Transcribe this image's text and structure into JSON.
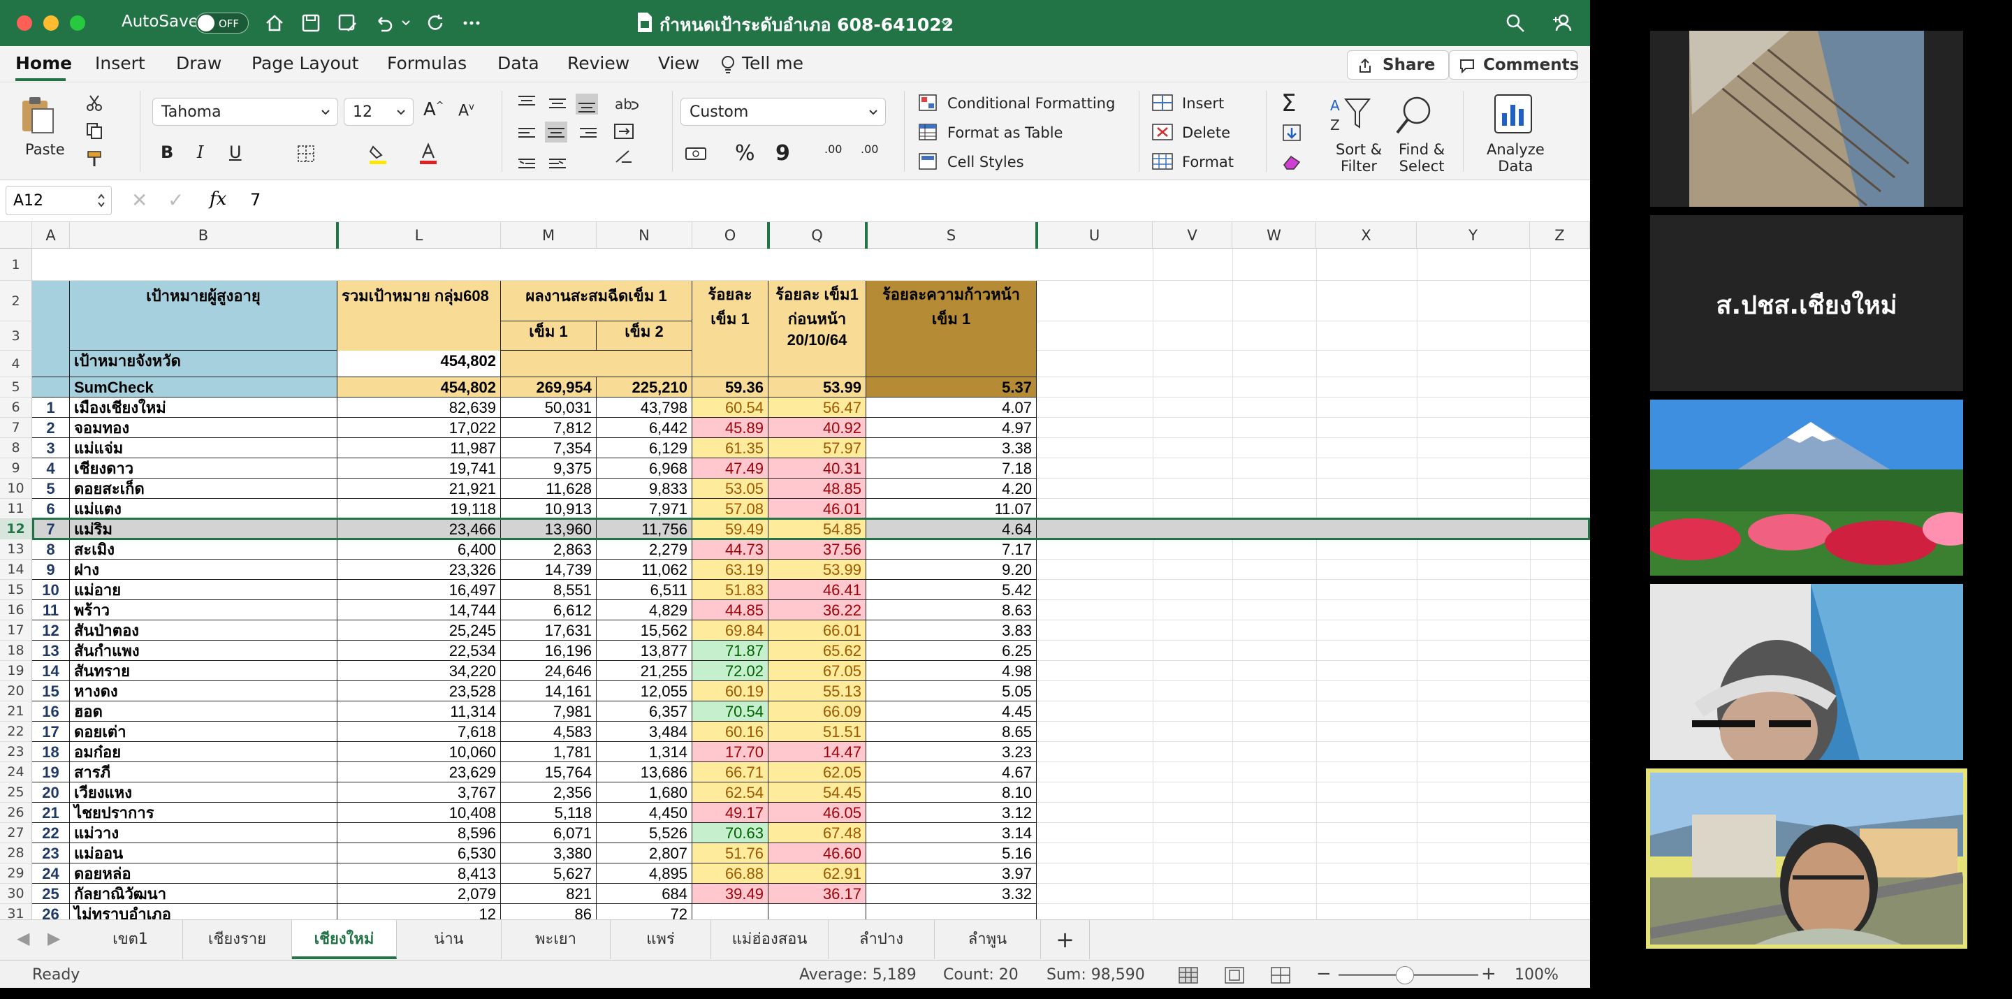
{
  "titlebar": {
    "autosave": "AutoSave",
    "off": "OFF",
    "doc_title": "กำหนดเป้าระดับอำเภอ 608-641022"
  },
  "menu": {
    "home": "Home",
    "insert": "Insert",
    "draw": "Draw",
    "page_layout": "Page Layout",
    "formulas": "Formulas",
    "data": "Data",
    "review": "Review",
    "view": "View",
    "tell_me": "Tell me",
    "share": "Share",
    "comments": "Comments"
  },
  "ribbon": {
    "paste": "Paste",
    "font_name": "Tahoma",
    "font_size": "12",
    "number_format": "Custom",
    "conditional_formatting": "Conditional Formatting",
    "format_as_table": "Format as Table",
    "cell_styles": "Cell Styles",
    "insert": "Insert",
    "delete": "Delete",
    "format": "Format",
    "sort_filter_1": "Sort &",
    "sort_filter_2": "Filter",
    "find_select_1": "Find &",
    "find_select_2": "Select",
    "analyze_1": "Analyze",
    "analyze_2": "Data",
    "bold": "B",
    "italic": "I",
    "underline": "U",
    "percent": "%",
    "comma": "9",
    "dec_inc": ".00",
    "dec_dec": ".00"
  },
  "formula_bar": {
    "name_box": "A12",
    "fx": "fx",
    "value": "7"
  },
  "columns": [
    "A",
    "B",
    "L",
    "M",
    "N",
    "O",
    "Q",
    "S",
    "U",
    "V",
    "W",
    "X",
    "Y",
    "Z"
  ],
  "headers": {
    "b": "เป้าหมายผู้สูงอายุ",
    "l": "รวมเป้าหมาย กลุ่ม608",
    "mn": "ผลงานสะสมฉีดเข็ม 1",
    "m": "เข็ม 1",
    "n": "เข็ม 2",
    "o": "ร้อยละ เข็ม 1",
    "q": "ร้อยละ เข็ม1 ก่อนหน้า 20/10/64",
    "s": "ร้อยละความก้าวหน้า เข็ม 1"
  },
  "province_target": {
    "label": "เป้าหมายจังหวัด",
    "value": "454,802"
  },
  "sumcheck": {
    "label": "SumCheck",
    "l": "454,802",
    "m": "269,954",
    "n": "225,210",
    "o": "59.36",
    "q": "53.99",
    "s": "5.37"
  },
  "rows": [
    {
      "n": "1",
      "name": "เมืองเชียงใหม่",
      "l": "82,639",
      "m": "50,031",
      "nn": "43,798",
      "o": "60.54",
      "q": "56.47",
      "s": "4.07"
    },
    {
      "n": "2",
      "name": "จอมทอง",
      "l": "17,022",
      "m": "7,812",
      "nn": "6,442",
      "o": "45.89",
      "q": "40.92",
      "s": "4.97"
    },
    {
      "n": "3",
      "name": "แม่แจ่ม",
      "l": "11,987",
      "m": "7,354",
      "nn": "6,129",
      "o": "61.35",
      "q": "57.97",
      "s": "3.38"
    },
    {
      "n": "4",
      "name": "เชียงดาว",
      "l": "19,741",
      "m": "9,375",
      "nn": "6,968",
      "o": "47.49",
      "q": "40.31",
      "s": "7.18"
    },
    {
      "n": "5",
      "name": "ดอยสะเก็ด",
      "l": "21,921",
      "m": "11,628",
      "nn": "9,833",
      "o": "53.05",
      "q": "48.85",
      "s": "4.20"
    },
    {
      "n": "6",
      "name": "แม่แตง",
      "l": "19,118",
      "m": "10,913",
      "nn": "7,971",
      "o": "57.08",
      "q": "46.01",
      "s": "11.07"
    },
    {
      "n": "7",
      "name": "แม่ริม",
      "l": "23,466",
      "m": "13,960",
      "nn": "11,756",
      "o": "59.49",
      "q": "54.85",
      "s": "4.64"
    },
    {
      "n": "8",
      "name": "สะเมิง",
      "l": "6,400",
      "m": "2,863",
      "nn": "2,279",
      "o": "44.73",
      "q": "37.56",
      "s": "7.17"
    },
    {
      "n": "9",
      "name": "ฝาง",
      "l": "23,326",
      "m": "14,739",
      "nn": "11,062",
      "o": "63.19",
      "q": "53.99",
      "s": "9.20"
    },
    {
      "n": "10",
      "name": "แม่อาย",
      "l": "16,497",
      "m": "8,551",
      "nn": "6,511",
      "o": "51.83",
      "q": "46.41",
      "s": "5.42"
    },
    {
      "n": "11",
      "name": "พร้าว",
      "l": "14,744",
      "m": "6,612",
      "nn": "4,829",
      "o": "44.85",
      "q": "36.22",
      "s": "8.63"
    },
    {
      "n": "12",
      "name": "สันป่าตอง",
      "l": "25,245",
      "m": "17,631",
      "nn": "15,562",
      "o": "69.84",
      "q": "66.01",
      "s": "3.83"
    },
    {
      "n": "13",
      "name": "สันกำแพง",
      "l": "22,534",
      "m": "16,196",
      "nn": "13,877",
      "o": "71.87",
      "q": "65.62",
      "s": "6.25"
    },
    {
      "n": "14",
      "name": "สันทราย",
      "l": "34,220",
      "m": "24,646",
      "nn": "21,255",
      "o": "72.02",
      "q": "67.05",
      "s": "4.98"
    },
    {
      "n": "15",
      "name": "หางดง",
      "l": "23,528",
      "m": "14,161",
      "nn": "12,055",
      "o": "60.19",
      "q": "55.13",
      "s": "5.05"
    },
    {
      "n": "16",
      "name": "ฮอด",
      "l": "11,314",
      "m": "7,981",
      "nn": "6,357",
      "o": "70.54",
      "q": "66.09",
      "s": "4.45"
    },
    {
      "n": "17",
      "name": "ดอยเต่า",
      "l": "7,618",
      "m": "4,583",
      "nn": "3,484",
      "o": "60.16",
      "q": "51.51",
      "s": "8.65"
    },
    {
      "n": "18",
      "name": "อมก๋อย",
      "l": "10,060",
      "m": "1,781",
      "nn": "1,314",
      "o": "17.70",
      "q": "14.47",
      "s": "3.23"
    },
    {
      "n": "19",
      "name": "สารภี",
      "l": "23,629",
      "m": "15,764",
      "nn": "13,686",
      "o": "66.71",
      "q": "62.05",
      "s": "4.67"
    },
    {
      "n": "20",
      "name": "เวียงแหง",
      "l": "3,767",
      "m": "2,356",
      "nn": "1,680",
      "o": "62.54",
      "q": "54.45",
      "s": "8.10"
    },
    {
      "n": "21",
      "name": "ไชยปราการ",
      "l": "10,408",
      "m": "5,118",
      "nn": "4,450",
      "o": "49.17",
      "q": "46.05",
      "s": "3.12"
    },
    {
      "n": "22",
      "name": "แม่วาง",
      "l": "8,596",
      "m": "6,071",
      "nn": "5,526",
      "o": "70.63",
      "q": "67.48",
      "s": "3.14"
    },
    {
      "n": "23",
      "name": "แม่ออน",
      "l": "6,530",
      "m": "3,380",
      "nn": "2,807",
      "o": "51.76",
      "q": "46.60",
      "s": "5.16"
    },
    {
      "n": "24",
      "name": "ดอยหล่อ",
      "l": "8,413",
      "m": "5,627",
      "nn": "4,895",
      "o": "66.88",
      "q": "62.91",
      "s": "3.97"
    },
    {
      "n": "25",
      "name": "กัลยาณิวัฒนา",
      "l": "2,079",
      "m": "821",
      "nn": "684",
      "o": "39.49",
      "q": "36.17",
      "s": "3.32"
    },
    {
      "n": "26",
      "name": "ไม่ทราบอำเภอ",
      "l": "12",
      "m": "86",
      "nn": "72",
      "o": "",
      "q": "",
      "s": ""
    }
  ],
  "sheet_tabs": [
    "เขต1",
    "เชียงราย",
    "เชียงใหม่",
    "น่าน",
    "พะเยา",
    "แพร่",
    "แม่ฮ่องสอน",
    "ลำปาง",
    "ลำพูน"
  ],
  "active_tab": "เชียงใหม่",
  "status": {
    "ready": "Ready",
    "average": "Average: 5,189",
    "count": "Count: 20",
    "sum": "Sum: 98,590",
    "zoom": "100%"
  },
  "participant": {
    "name": "ส.ปชส.เชียงใหม่"
  },
  "colors": {
    "green": "#227447",
    "lightblue": "#a7d0de",
    "yellow": "#f8dc96",
    "gold": "#b58b35",
    "good": "#c6efce",
    "mid": "#ffeb9c",
    "bad": "#ffc7ce"
  }
}
